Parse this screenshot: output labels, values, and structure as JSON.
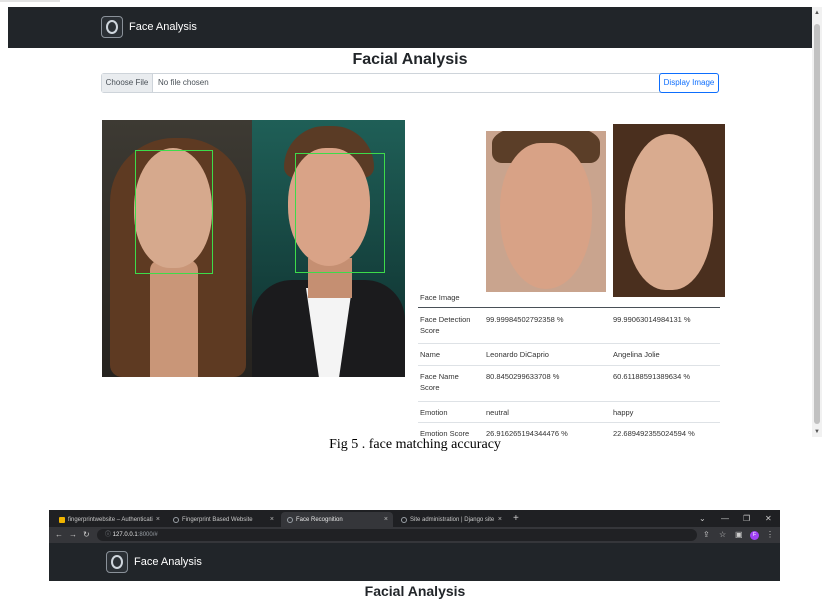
{
  "app": {
    "brand": "Face Analysis",
    "page_title": "Facial Analysis"
  },
  "file_input": {
    "choose_label": "Choose File",
    "status": "No file chosen",
    "display_button": "Display Image"
  },
  "results": {
    "labels": {
      "face_image": "Face Image",
      "detection_score_1": "Face Detection",
      "detection_score_2": "Score",
      "name": "Name",
      "name_score_1": "Face Name",
      "name_score_2": "Score",
      "emotion": "Emotion",
      "emotion_score": "Emotion Score"
    },
    "faces": [
      {
        "detection_score": "99.99984502792358 %",
        "name": "Leonardo DiCaprio",
        "name_score": "80.8450299633708 %",
        "emotion": "neutral",
        "emotion_score": "26.916265194344476 %"
      },
      {
        "detection_score": "99.99063014984131 %",
        "name": "Angelina Jolie",
        "name_score": "60.61188591389634 %",
        "emotion": "happy",
        "emotion_score": "22.689492355024594 %"
      }
    ]
  },
  "caption": "Fig 5 . face matching accuracy",
  "browser": {
    "tabs": [
      {
        "label": "fingerprintwebsite – Authenticati",
        "icon": "folder-icon"
      },
      {
        "label": "Fingerprint Based Website",
        "icon": "globe-icon"
      },
      {
        "label": "Face Recognition",
        "icon": "globe-icon",
        "active": true
      },
      {
        "label": "Site administration | Django site",
        "icon": "globe-icon"
      }
    ],
    "close_glyph": "×",
    "new_tab_glyph": "+",
    "url_host": "127.0.0.1",
    "url_rest": ":8000/#",
    "profile_initial": "F"
  },
  "colors": {
    "navbar": "#212529",
    "detection_box": "#3ddb4a",
    "primary": "#0d6efd"
  }
}
